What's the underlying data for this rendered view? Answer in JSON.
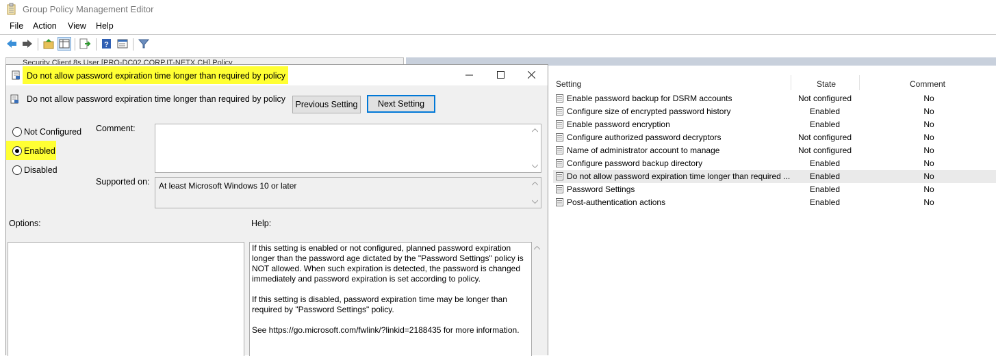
{
  "window": {
    "title": "Group Policy Management Editor"
  },
  "menu": [
    {
      "label": "File"
    },
    {
      "label": "Action"
    },
    {
      "label": "View"
    },
    {
      "label": "Help"
    }
  ],
  "toolbar_icons": [
    "back-arrow-icon",
    "forward-arrow-icon",
    "folder-up-icon",
    "show-hide-console-tree-icon",
    "export-list-icon",
    "help-icon",
    "properties-icon",
    "filter-icon"
  ],
  "tree": {
    "partial_text": "Security Client 8s User [PRO-DC02.CORP.IT-NETX.CH] Policy"
  },
  "dialog": {
    "title": "Do not allow password expiration time longer than required by policy",
    "setting_name": "Do not allow password expiration time longer than required by policy",
    "prev_button": "Previous Setting",
    "next_button": "Next Setting",
    "radios": [
      {
        "label": "Not Configured",
        "checked": false
      },
      {
        "label": "Enabled",
        "checked": true
      },
      {
        "label": "Disabled",
        "checked": false
      }
    ],
    "comment_label": "Comment:",
    "comment_value": "",
    "supported_label": "Supported on:",
    "supported_value": "At least Microsoft Windows 10 or later",
    "options_label": "Options:",
    "help_label": "Help:",
    "help_text": "If this setting is enabled or not configured, planned password expiration\nlonger than the password age dictated by the \"Password Settings\" policy is\nNOT allowed. When such expiration is detected, the password is changed\nimmediately and password expiration is set according to policy.\n\nIf this setting is disabled, password expiration time may be longer than\nrequired by \"Password Settings\" policy.\n\nSee https://go.microsoft.com/fwlink/?linkid=2188435 for more information.",
    "highlight_color": "#ffff33"
  },
  "list": {
    "columns": [
      "Setting",
      "State",
      "Comment"
    ],
    "rows": [
      {
        "name": "Enable password backup for DSRM accounts",
        "state": "Not configured",
        "comment": "No"
      },
      {
        "name": "Configure size of encrypted password history",
        "state": "Enabled",
        "comment": "No"
      },
      {
        "name": "Enable password encryption",
        "state": "Enabled",
        "comment": "No"
      },
      {
        "name": "Configure authorized password decryptors",
        "state": "Not configured",
        "comment": "No"
      },
      {
        "name": "Name of administrator account to manage",
        "state": "Not configured",
        "comment": "No"
      },
      {
        "name": "Configure password backup directory",
        "state": "Enabled",
        "comment": "No"
      },
      {
        "name": "Do not allow password expiration time longer than required ...",
        "state": "Enabled",
        "comment": "No"
      },
      {
        "name": "Password Settings",
        "state": "Enabled",
        "comment": "No"
      },
      {
        "name": "Post-authentication actions",
        "state": "Enabled",
        "comment": "No"
      }
    ]
  }
}
